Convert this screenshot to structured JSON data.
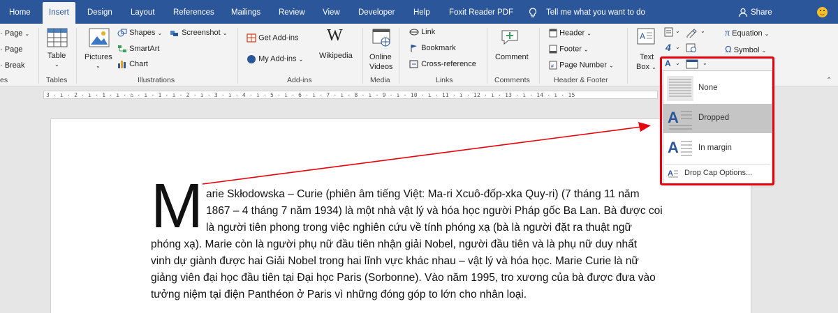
{
  "tabs": [
    {
      "label": "Home"
    },
    {
      "label": "Insert"
    },
    {
      "label": "Design"
    },
    {
      "label": "Layout"
    },
    {
      "label": "References"
    },
    {
      "label": "Mailings"
    },
    {
      "label": "Review"
    },
    {
      "label": "View"
    },
    {
      "label": "Developer"
    },
    {
      "label": "Help"
    },
    {
      "label": "Foxit Reader PDF"
    }
  ],
  "tell_me": "Tell me what you want to do",
  "share": "Share",
  "ribbon": {
    "pages": {
      "page": "Page",
      "page2": "Page",
      "break": "Break",
      "group": "es"
    },
    "tables": {
      "table": "Table",
      "group": "Tables"
    },
    "illustrations": {
      "pictures": "Pictures",
      "shapes": "Shapes",
      "smartart": "SmartArt",
      "chart": "Chart",
      "screenshot": "Screenshot",
      "group": "Illustrations"
    },
    "addins": {
      "get": "Get Add-ins",
      "my": "My Add-ins",
      "wikipedia": "Wikipedia",
      "group": "Add-ins"
    },
    "media": {
      "online": "Online",
      "videos": "Videos",
      "group": "Media"
    },
    "links": {
      "link": "Link",
      "bookmark": "Bookmark",
      "cross": "Cross-reference",
      "group": "Links"
    },
    "comments": {
      "comment": "Comment",
      "group": "Comments"
    },
    "header_footer": {
      "header": "Header",
      "footer": "Footer",
      "page_number": "Page Number",
      "group": "Header & Footer"
    },
    "text": {
      "text": "Text",
      "box": "Box"
    },
    "symbols": {
      "equation": "Equation",
      "symbol": "Symbol"
    }
  },
  "ruler": "3 · ı · 2 · ı · 1 · ı · ⌂ · ı · 1 · ı · 2 · ı · 3 · ı · 4 · ı · 5 · ı · 6 · ı · 7 · ı · 8 · ı · 9 · ı · 10 · ı · 11 · ı · 12 · ı · 13 · ı · 14 · ı · 15",
  "document": {
    "drop_cap": "M",
    "lines": [
      "arie Skłodowska – Curie (phiên âm tiếng Việt: Ma-ri Xcuô-đốp-xka Quy-ri) (7 tháng 11 năm",
      "1867 – 4 tháng 7 năm 1934) là một nhà vật lý và hóa học người Pháp gốc Ba Lan. Bà được coi",
      "là người tiên phong trong việc nghiên cứu về tính phóng xạ  (bà là người đặt ra thuật ngữ",
      "phóng xạ). Marie còn là người phụ nữ đầu tiên nhận giải Nobel, người đầu tiên và là phụ nữ duy nhất",
      "vinh dự giành được hai Giải Nobel trong hai lĩnh vực khác nhau – vật lý và hóa học. Marie Curie là nữ",
      "giảng viên đại học đầu tiên tại Đại học Paris (Sorbonne). Vào năm 1995, tro xương của bà được đưa vào",
      "tưởng niệm tại điện Panthéon ở Paris vì những đóng góp to lớn cho nhân loại."
    ]
  },
  "dropcap_menu": {
    "items": [
      {
        "label": "None"
      },
      {
        "label": "Dropped"
      },
      {
        "label": "In margin"
      }
    ],
    "selected": "Dropped",
    "options": "Drop Cap Options..."
  },
  "colors": {
    "tabbar": "#2b579a",
    "highlight": "#e8000b"
  }
}
